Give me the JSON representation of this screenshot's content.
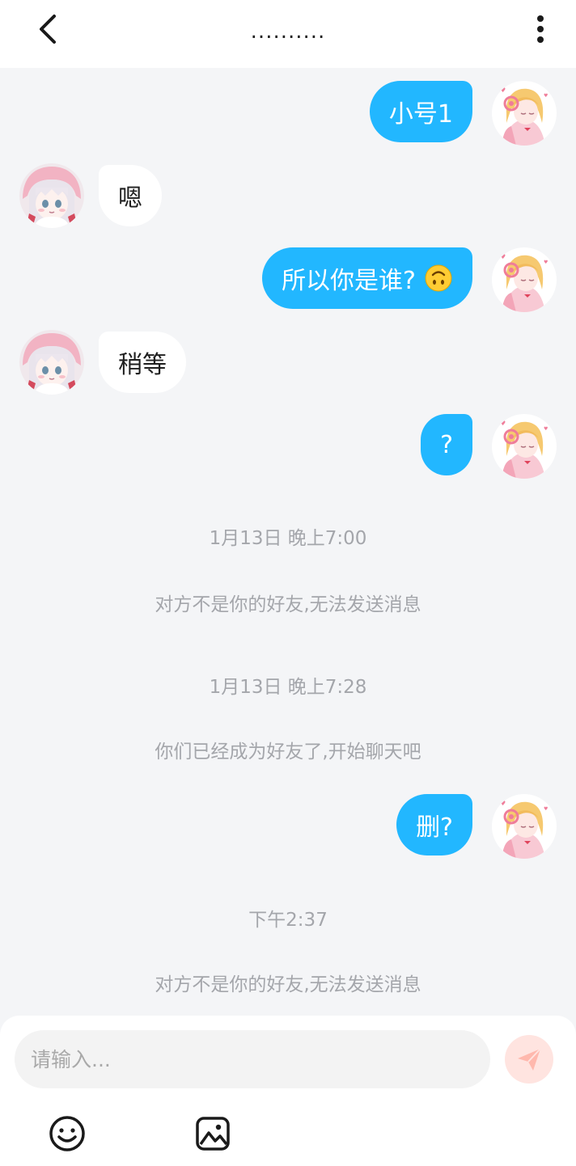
{
  "header": {
    "title": "..........",
    "back_icon": "chevron-left-icon",
    "more_icon": "more-vertical-icon"
  },
  "messages": [
    {
      "direction": "out",
      "text": "小号1"
    },
    {
      "direction": "in",
      "text": "嗯"
    },
    {
      "direction": "out",
      "text": "所以你是谁?",
      "emoji": "upside-down-face-emoji"
    },
    {
      "direction": "in",
      "text": "稍等"
    },
    {
      "direction": "out",
      "text": "?"
    },
    {
      "direction": "out",
      "text": "删?"
    }
  ],
  "system": [
    {
      "kind": "time",
      "text": "1月13日 晚上7:00"
    },
    {
      "kind": "notice",
      "text": "对方不是你的好友,无法发送消息"
    },
    {
      "kind": "time",
      "text": "1月13日 晚上7:28"
    },
    {
      "kind": "notice",
      "text": "你们已经成为好友了,开始聊天吧"
    },
    {
      "kind": "time",
      "text": "下午2:37"
    },
    {
      "kind": "notice",
      "text": "对方不是你的好友,无法发送消息"
    }
  ],
  "input": {
    "placeholder": "请输入...",
    "value": ""
  },
  "toolbar": {
    "send_icon": "paper-plane-icon",
    "emoji_icon": "smiley-icon",
    "image_icon": "image-icon"
  },
  "colors": {
    "accent": "#22b7ff",
    "background": "#f4f5f7",
    "send_button": "#ffe4e0",
    "system_text": "#a4a6ab"
  }
}
